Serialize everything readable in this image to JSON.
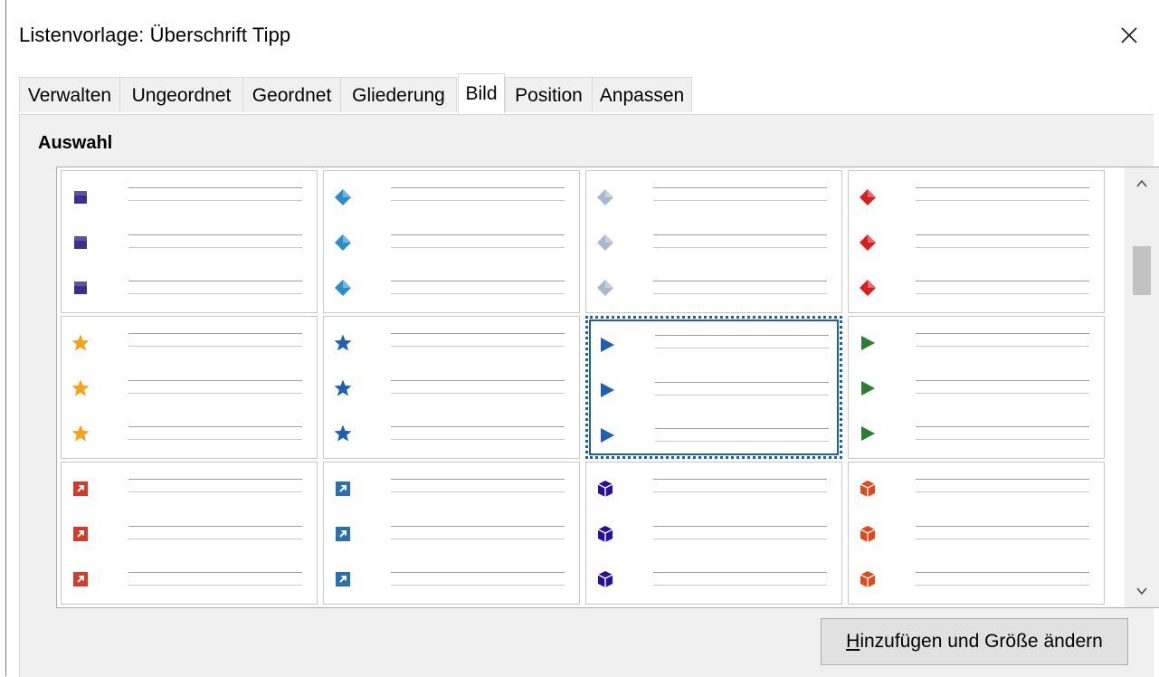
{
  "window": {
    "title": "Listenvorlage: Überschrift Tipp",
    "close_icon": "close-icon"
  },
  "tabs": [
    {
      "label": "Verwalten",
      "active": false
    },
    {
      "label": "Ungeordnet",
      "active": false
    },
    {
      "label": "Geordnet",
      "active": false
    },
    {
      "label": "Gliederung",
      "active": false
    },
    {
      "label": "Bild",
      "active": true
    },
    {
      "label": "Position",
      "active": false
    },
    {
      "label": "Anpassen",
      "active": false
    }
  ],
  "section": {
    "label": "Auswahl"
  },
  "gallery": {
    "rows": [
      [
        {
          "icon": "purple-square-icon",
          "color": "#3c2f8c"
        },
        {
          "icon": "blue-diamond-icon",
          "color": "#2a8fc7"
        },
        {
          "icon": "silver-diamond-icon",
          "color": "#a9b8cc"
        },
        {
          "icon": "red-diamond-icon",
          "color": "#d81e1e"
        }
      ],
      [
        {
          "icon": "orange-star-icon",
          "color": "#f5a11a"
        },
        {
          "icon": "blue-star-icon",
          "color": "#1f5fb0"
        },
        {
          "icon": "blue-arrow-icon",
          "color": "#1f5fb0",
          "selected": true
        },
        {
          "icon": "green-arrow-icon",
          "color": "#2e7d32"
        }
      ],
      [
        {
          "icon": "red-arrow-box-icon",
          "color": "#d63a2a"
        },
        {
          "icon": "blue-arrow-box-icon",
          "color": "#2a6fb0"
        },
        {
          "icon": "purple-cube-icon",
          "color": "#2a0f9e"
        },
        {
          "icon": "orange-cube-icon",
          "color": "#e2481c"
        }
      ]
    ],
    "scroll_up_icon": "chevron-up-icon",
    "scroll_down_icon": "chevron-down-icon"
  },
  "button": {
    "label_mnemonic": "H",
    "label_rest": "inzufügen und Größe ändern"
  }
}
